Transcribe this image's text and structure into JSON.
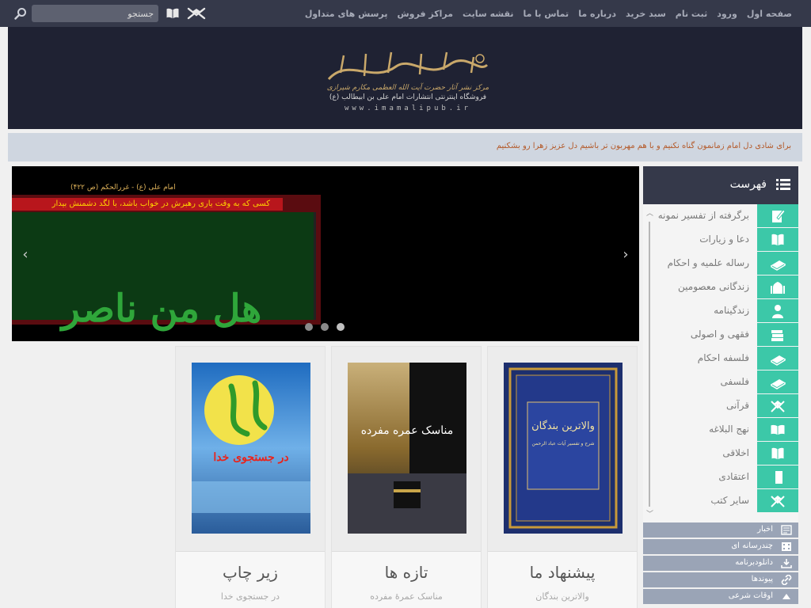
{
  "topnav": {
    "items": [
      "صفحه اول",
      "ورود",
      "ثبت نام",
      "سبد خرید",
      "درباره ما",
      "تماس با ما",
      "نقشه سایت",
      "مراکز فروش",
      "پرسش های متداول"
    ]
  },
  "search": {
    "placeholder": "جستجو"
  },
  "header": {
    "logo_title": "مرکز نشر آثار حضرت آیت الله العظمی مکارم شیرازی",
    "logo_subtitle": "فروشگاه اینترنتی انتشارات امام علی بن ابیطالب (ع)",
    "logo_url": "www.imamalipub.ir"
  },
  "ticker": {
    "text": "برای شادی دل امام زمانمون گناه نکنیم و با هم مهربون تر باشیم دل عزیز زهرا رو بشکنیم"
  },
  "slider": {
    "top_caption": "امام علی (ع) - غررالحکم (ص ۴۲۲)",
    "red_caption": "کسی که به وقت یاری رهبرش در خواب باشد، با لگد دشمنش بیدار",
    "calligraphy": "هل من ناصر ینصرنی",
    "prev_label": "‹",
    "next_label": "›",
    "dot_count": 3
  },
  "cards": [
    {
      "title": "پیشنهاد ما",
      "subtitle": "والاترین بندگان",
      "book_title": "والاترین بندگان",
      "book_sub": "شرح و تفسیر آیات عباد الرحمن"
    },
    {
      "title": "تازه ها",
      "subtitle": "مناسک عمرۀ مفرده",
      "book_title": "مناسک عمره مفرده"
    },
    {
      "title": "زیر چاپ",
      "subtitle": "در جستجوی خدا",
      "book_title": "در جستجوی خدا"
    }
  ],
  "sidebar": {
    "header": "فهرست",
    "items": [
      {
        "label": "برگرفته از تفسیر نمونه",
        "icon": "pen-book-icon"
      },
      {
        "label": "دعا و زیارات",
        "icon": "open-book-icon"
      },
      {
        "label": "رساله علمیه و احکام",
        "icon": "book-icon"
      },
      {
        "label": "زندگانی معصومین",
        "icon": "mosque-icon"
      },
      {
        "label": "زندگینامه",
        "icon": "person-icon"
      },
      {
        "label": "فقهی و اصولی",
        "icon": "books-stack-icon"
      },
      {
        "label": "فلسفه احکام",
        "icon": "book-icon"
      },
      {
        "label": "فلسفی",
        "icon": "book-icon"
      },
      {
        "label": "قرآنی",
        "icon": "quran-stand-icon"
      },
      {
        "label": "نهج البلاغه",
        "icon": "open-book-icon"
      },
      {
        "label": "اخلاقی",
        "icon": "open-book-icon"
      },
      {
        "label": "اعتقادی",
        "icon": "book-icon"
      },
      {
        "label": "سایر کتب",
        "icon": "quran-stand-icon"
      }
    ],
    "accordion": [
      {
        "label": "اخبار",
        "icon": "newspaper-icon"
      },
      {
        "label": "چندرسانه ای",
        "icon": "film-icon"
      },
      {
        "label": "دانلودبرنامه",
        "icon": "download-icon"
      },
      {
        "label": "پیوندها",
        "icon": "link-icon"
      },
      {
        "label": "اوقات شرعی",
        "icon": "chevron-up-icon"
      }
    ]
  },
  "colors": {
    "topbar": "#35394a",
    "header": "#1f2233",
    "accent": "#3cc8a8",
    "ticker_text": "#b45a2a",
    "accordion": "#9aa4b6"
  }
}
